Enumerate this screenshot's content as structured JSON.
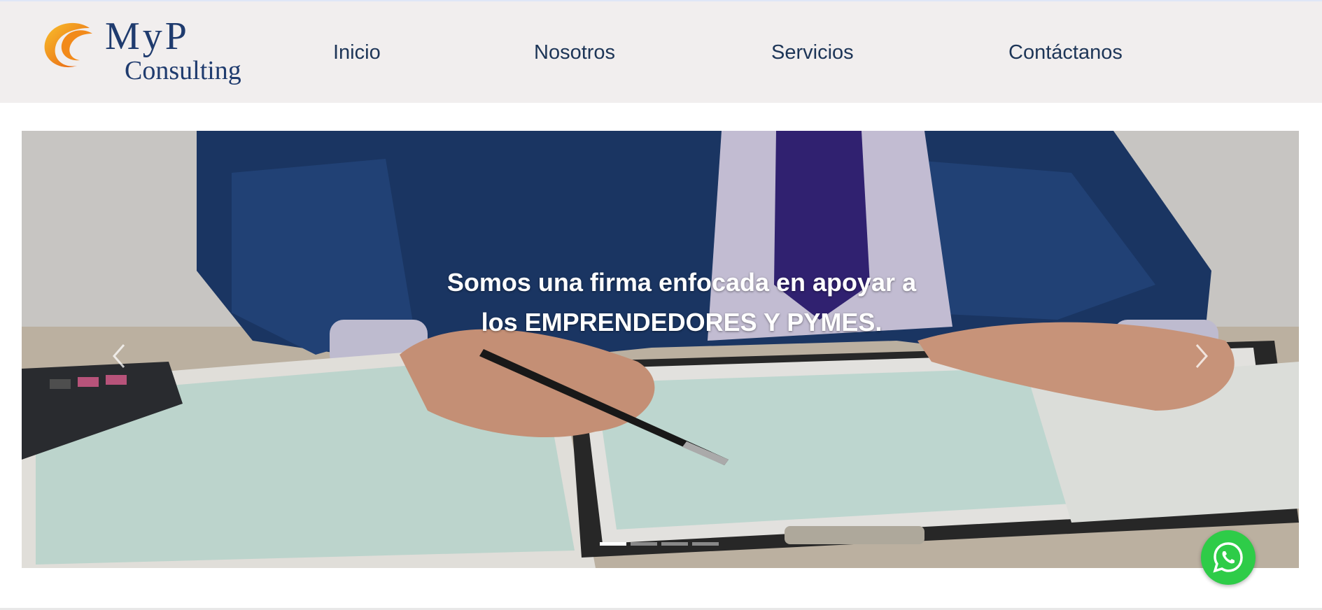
{
  "brand": {
    "logo_line1": "MyP",
    "logo_line2": "Consulting",
    "colors": {
      "navy": "#1f3b6e",
      "orange": "#f28a1a"
    }
  },
  "nav": {
    "items": [
      {
        "label": "Inicio"
      },
      {
        "label": "Nosotros"
      },
      {
        "label": "Servicios"
      },
      {
        "label": "Contáctanos"
      }
    ]
  },
  "hero": {
    "caption": "Somos una firma enfocada en apoyar a los EMPRENDEDORES Y PYMES.",
    "prev_icon": "chevron-left-icon",
    "next_icon": "chevron-right-icon",
    "slide_count": 4,
    "active_slide": 1
  },
  "whatsapp": {
    "icon": "whatsapp-icon",
    "color": "#2ecc48"
  }
}
